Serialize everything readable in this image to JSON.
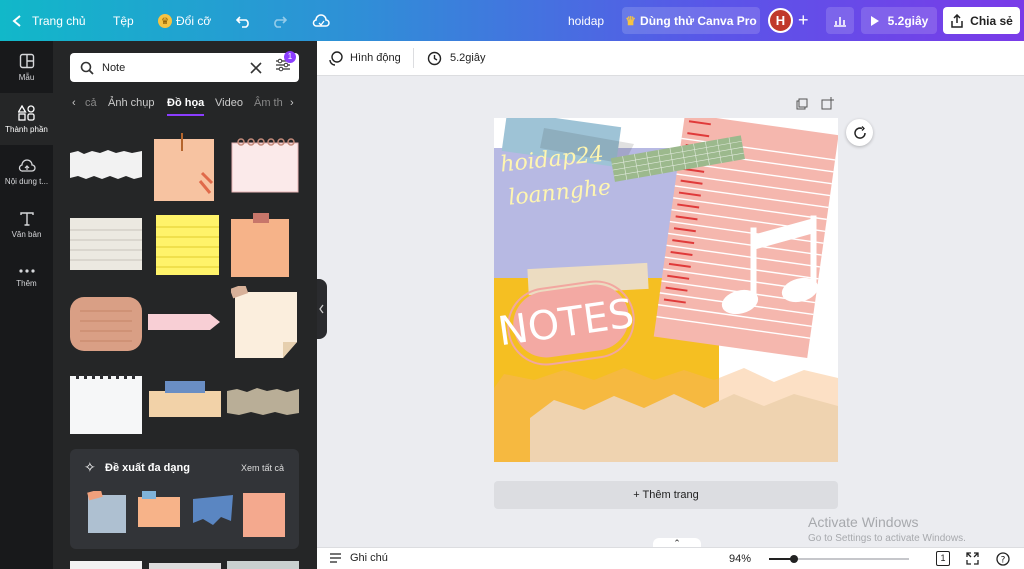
{
  "topbar": {
    "home_label": "Trang chủ",
    "file_label": "Tệp",
    "resize_label": "Đổi cỡ",
    "doc_title": "hoidap",
    "try_pro_label": "Dùng thử Canva Pro",
    "avatar_letter": "H",
    "play_label": "5.2giây",
    "share_label": "Chia sẻ",
    "crown_icon": "crown-icon",
    "colors": {
      "avatar": "#c0392b",
      "share_bg": "#ffffff"
    }
  },
  "rail": {
    "items": [
      {
        "label": "Mẫu",
        "icon": "template-icon"
      },
      {
        "label": "Thành phần",
        "icon": "elements-icon"
      },
      {
        "label": "Nội dung t...",
        "icon": "upload-icon"
      },
      {
        "label": "Văn bản",
        "icon": "text-icon"
      },
      {
        "label": "Thêm",
        "icon": "more-icon"
      }
    ]
  },
  "panel": {
    "search_value": "Note",
    "filter_badge": "1",
    "tabs": [
      "cả",
      "Ảnh chụp",
      "Đồ họa",
      "Video",
      "Âm th"
    ],
    "active_tab": "Đồ họa",
    "suggest_title": "Đề xuất đa dạng",
    "see_all": "Xem tất cả"
  },
  "editor": {
    "animation_label": "Hình động",
    "duration_label": "5.2giây",
    "add_page_label": "+ Thêm trang",
    "canvas_texts": {
      "handwriting_1": "hoidap24",
      "handwriting_2": "loannghe",
      "notes_sticker": "NOTES"
    }
  },
  "bottombar": {
    "notes_label": "Ghi chú",
    "zoom": "94%",
    "page_count": "1"
  },
  "watermark": {
    "line1": "Activate Windows",
    "line2": "Go to Settings to activate Windows."
  }
}
